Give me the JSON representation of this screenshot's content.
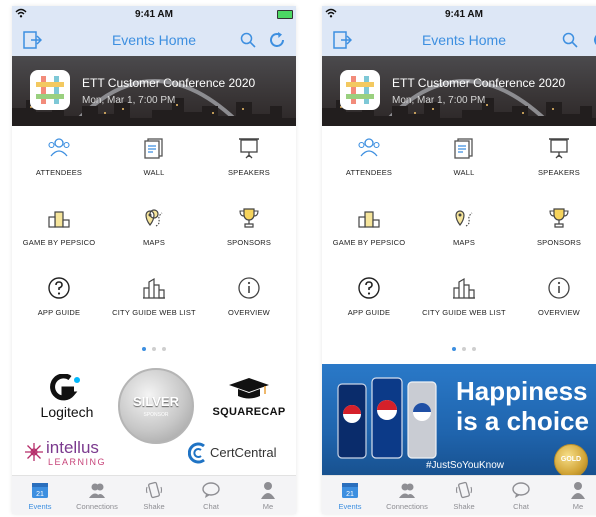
{
  "statusbar": {
    "time": "9:41 AM"
  },
  "navbar": {
    "title": "Events Home"
  },
  "event": {
    "title": "ETT Customer Conference 2020",
    "date": "Mon, Mar 1, 7:00 PM"
  },
  "grid": {
    "attendees": "ATTENDEES",
    "wall": "WALL",
    "speakers": "SPEAKERS",
    "game": "GAME BY PEPSICO",
    "maps": "MAPS",
    "sponsors": "SPONSORS",
    "app_guide": "APP GUIDE",
    "city_guide": "CITY GUIDE WEB LIST",
    "overview": "OVERVIEW"
  },
  "pagination": {
    "pages": 3,
    "current": 1
  },
  "sponsor_logos": {
    "logitech": "Logitech",
    "silver": "SILVER",
    "silver_sub": "SPONSOR",
    "squarecap": "SQUARECAP",
    "intellus_1": "intellus",
    "intellus_2": "LEARNING",
    "certcentral": "CertCentral"
  },
  "ad": {
    "line1": "Happiness",
    "line2": "is a choice",
    "hashtag": "#JustSoYouKnow",
    "badge": "GOLD",
    "brand": "pepsi"
  },
  "tabs": {
    "events": "Events",
    "connections": "Connections",
    "shake": "Shake",
    "chat": "Chat",
    "me": "Me",
    "calendar_day": "21"
  },
  "colors": {
    "accent": "#3d8fe0",
    "navbar_bg": "#dde7f6",
    "tab_inactive": "#8e8e93"
  }
}
